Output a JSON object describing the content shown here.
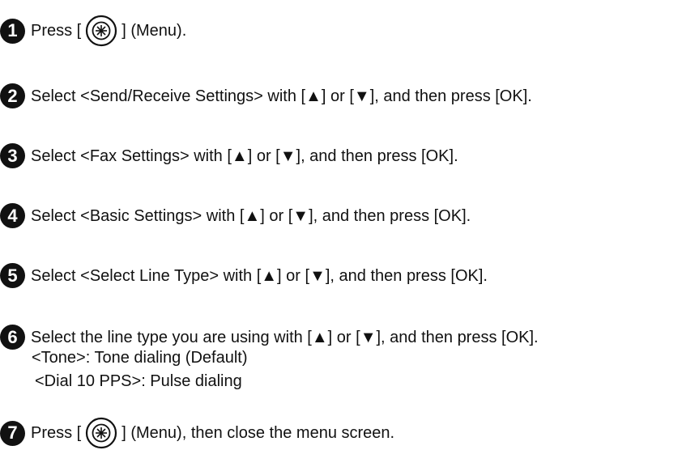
{
  "steps": [
    {
      "number": "1",
      "prefix": "Press [",
      "suffix": "] (Menu).",
      "icon": "menu-button-icon"
    },
    {
      "number": "2",
      "prefix": "Select <Send/Receive Settings> with [",
      "middle": "] or [",
      "suffix": "], and then press [OK].",
      "up_icon": "▲",
      "down_icon": "▼"
    },
    {
      "number": "3",
      "prefix": "Select <Fax Settings> with [",
      "middle": "] or [",
      "suffix": "], and then press [OK].",
      "up_icon": "▲",
      "down_icon": "▼"
    },
    {
      "number": "4",
      "prefix": "Select <Basic Settings> with [",
      "middle": "] or [",
      "suffix": "], and then press [OK].",
      "up_icon": "▲",
      "down_icon": "▼"
    },
    {
      "number": "5",
      "prefix": "Select <Select Line Type> with [",
      "middle": "] or [",
      "suffix": "], and then press [OK].",
      "up_icon": "▲",
      "down_icon": "▼"
    },
    {
      "number": "6",
      "prefix": "Select the line type you are using with [",
      "middle": "] or [",
      "suffix": "], and then press [OK].",
      "up_icon": "▲",
      "down_icon": "▼",
      "options": [
        "<Tone>: Tone dialing (Default)",
        "<Dial 10 PPS>: Pulse dialing"
      ]
    },
    {
      "number": "7",
      "prefix": "Press [",
      "suffix": "] (Menu), then close the menu screen.",
      "icon": "menu-button-icon"
    }
  ]
}
